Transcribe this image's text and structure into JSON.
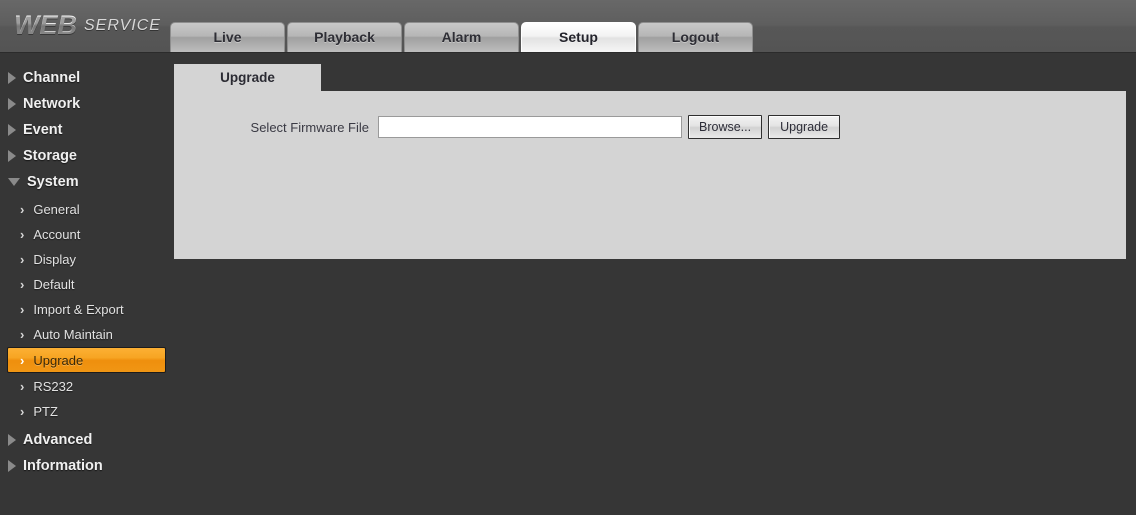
{
  "header": {
    "logo_primary": "WEB",
    "logo_secondary": "SERVICE",
    "tabs": [
      {
        "label": "Live",
        "active": false
      },
      {
        "label": "Playback",
        "active": false
      },
      {
        "label": "Alarm",
        "active": false
      },
      {
        "label": "Setup",
        "active": true
      },
      {
        "label": "Logout",
        "active": false
      }
    ]
  },
  "sidebar": {
    "groups": [
      {
        "label": "Channel",
        "icon": "triangle-right-icon",
        "expanded": false
      },
      {
        "label": "Network",
        "icon": "triangle-right-icon",
        "expanded": false
      },
      {
        "label": "Event",
        "icon": "triangle-right-icon",
        "expanded": false
      },
      {
        "label": "Storage",
        "icon": "triangle-right-icon",
        "expanded": false
      },
      {
        "label": "System",
        "icon": "triangle-down-icon",
        "expanded": true
      }
    ],
    "system_items": [
      {
        "label": "General",
        "icon": "chevron-right-icon",
        "active": false
      },
      {
        "label": "Account",
        "icon": "chevron-right-icon",
        "active": false
      },
      {
        "label": "Display",
        "icon": "chevron-right-icon",
        "active": false
      },
      {
        "label": "Default",
        "icon": "chevron-right-icon",
        "active": false
      },
      {
        "label": "Import & Export",
        "icon": "chevron-right-icon",
        "active": false
      },
      {
        "label": "Auto Maintain",
        "icon": "chevron-right-icon",
        "active": false
      },
      {
        "label": "Upgrade",
        "icon": "chevron-right-icon",
        "active": true
      },
      {
        "label": "RS232",
        "icon": "chevron-right-icon",
        "active": false
      },
      {
        "label": "PTZ",
        "icon": "chevron-right-icon",
        "active": false
      }
    ],
    "groups_tail": [
      {
        "label": "Advanced",
        "icon": "triangle-right-icon",
        "expanded": false
      },
      {
        "label": "Information",
        "icon": "triangle-right-icon",
        "expanded": false
      }
    ],
    "chevron_glyph": "›"
  },
  "content": {
    "panel_tab_label": "Upgrade",
    "form": {
      "label": "Select Firmware File",
      "input_value": "",
      "input_placeholder": "",
      "browse_button": "Browse...",
      "upgrade_button": "Upgrade"
    }
  },
  "colors": {
    "header_bg": "#5b5b5b",
    "body_bg": "#363636",
    "panel_bg": "#d4d4d4",
    "accent_orange": "#f5a623",
    "active_tab_bg": "#f3f3f3"
  }
}
